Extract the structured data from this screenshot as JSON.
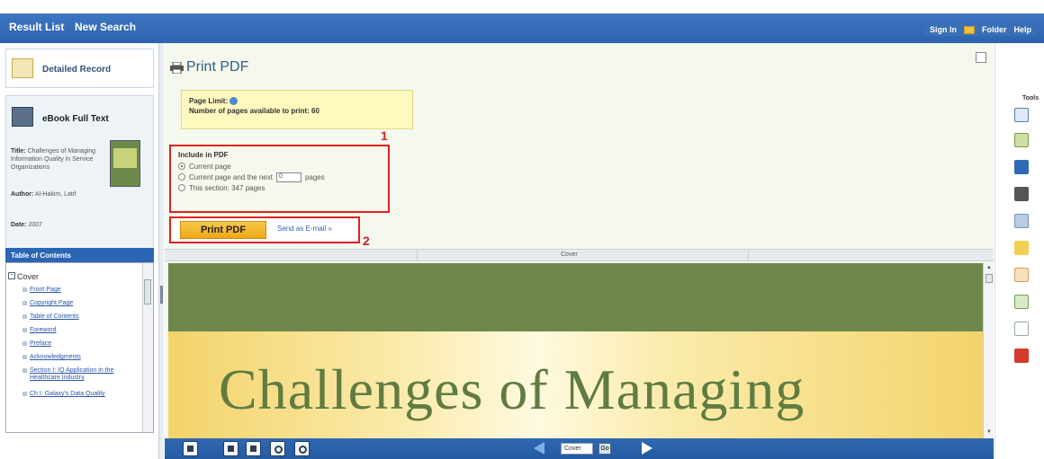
{
  "topbar": {
    "result_list": "Result List",
    "new_search": "New Search",
    "sign_in": "Sign In",
    "folder": "Folder",
    "help": "Help"
  },
  "sidebar": {
    "detailed_record": "Detailed Record",
    "ebook_full_text": "eBook Full Text",
    "meta": {
      "title_label": "Title:",
      "title_value": "Challenges of Managing Information Quality in Service Organizations",
      "author_label": "Author:",
      "author_value": "Al-Hakim, Latif",
      "date_label": "Date:",
      "date_value": "2007"
    },
    "toc_header": "Table of Contents",
    "toc_cover": "Cover",
    "toc_items": [
      "Front Page",
      "Copyright Page",
      "Table of Contents",
      "Foreword",
      "Preface",
      "Acknowledgments",
      "Section I: IQ Application in the Healthcare Industry",
      "Ch I: Galaxy's Data Quality"
    ]
  },
  "print_pdf": {
    "title": "Print PDF",
    "page_limit_label": "Page Limit:",
    "pages_available": "Number of pages available to print: 60",
    "include_header": "Include in PDF",
    "option_current": "Current page",
    "option_next_prefix": "Current page and the next",
    "option_next_value": "0",
    "option_next_suffix": "pages",
    "option_section": "This section: 347 pages",
    "marker_1": "1",
    "marker_2": "2",
    "print_button": "Print PDF",
    "send_email": "Send as E-mail »"
  },
  "viewer": {
    "strip_label": "Cover",
    "cover_title": "Challenges of Managing",
    "page_select": "Cover",
    "go": "Go"
  },
  "tools": {
    "label": "Tools"
  },
  "colors": {
    "topbar": "#2d63ad",
    "panel_bg": "#f5f8ec",
    "highlight_border": "#d22222",
    "print_button": "#f0a818",
    "cover_green": "#6f874c",
    "cover_gold": "#f3d36a"
  }
}
